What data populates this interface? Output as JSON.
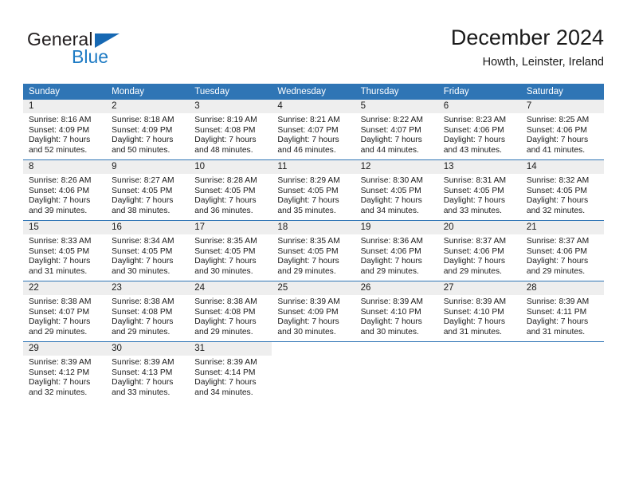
{
  "brand": {
    "name_part1": "General",
    "name_part2": "Blue",
    "triangle_color": "#1668b3",
    "blue_color": "#1e7bc4"
  },
  "header": {
    "title": "December 2024",
    "subtitle": "Howth, Leinster, Ireland"
  },
  "theme": {
    "header_bg": "#2f75b5",
    "day_band_bg": "#eeeeee",
    "text": "#1a1a1a"
  },
  "weekday_headers": [
    "Sunday",
    "Monday",
    "Tuesday",
    "Wednesday",
    "Thursday",
    "Friday",
    "Saturday"
  ],
  "weeks": [
    [
      {
        "day": "1",
        "sunrise": "Sunrise: 8:16 AM",
        "sunset": "Sunset: 4:09 PM",
        "daylight1": "Daylight: 7 hours",
        "daylight2": "and 52 minutes."
      },
      {
        "day": "2",
        "sunrise": "Sunrise: 8:18 AM",
        "sunset": "Sunset: 4:09 PM",
        "daylight1": "Daylight: 7 hours",
        "daylight2": "and 50 minutes."
      },
      {
        "day": "3",
        "sunrise": "Sunrise: 8:19 AM",
        "sunset": "Sunset: 4:08 PM",
        "daylight1": "Daylight: 7 hours",
        "daylight2": "and 48 minutes."
      },
      {
        "day": "4",
        "sunrise": "Sunrise: 8:21 AM",
        "sunset": "Sunset: 4:07 PM",
        "daylight1": "Daylight: 7 hours",
        "daylight2": "and 46 minutes."
      },
      {
        "day": "5",
        "sunrise": "Sunrise: 8:22 AM",
        "sunset": "Sunset: 4:07 PM",
        "daylight1": "Daylight: 7 hours",
        "daylight2": "and 44 minutes."
      },
      {
        "day": "6",
        "sunrise": "Sunrise: 8:23 AM",
        "sunset": "Sunset: 4:06 PM",
        "daylight1": "Daylight: 7 hours",
        "daylight2": "and 43 minutes."
      },
      {
        "day": "7",
        "sunrise": "Sunrise: 8:25 AM",
        "sunset": "Sunset: 4:06 PM",
        "daylight1": "Daylight: 7 hours",
        "daylight2": "and 41 minutes."
      }
    ],
    [
      {
        "day": "8",
        "sunrise": "Sunrise: 8:26 AM",
        "sunset": "Sunset: 4:06 PM",
        "daylight1": "Daylight: 7 hours",
        "daylight2": "and 39 minutes."
      },
      {
        "day": "9",
        "sunrise": "Sunrise: 8:27 AM",
        "sunset": "Sunset: 4:05 PM",
        "daylight1": "Daylight: 7 hours",
        "daylight2": "and 38 minutes."
      },
      {
        "day": "10",
        "sunrise": "Sunrise: 8:28 AM",
        "sunset": "Sunset: 4:05 PM",
        "daylight1": "Daylight: 7 hours",
        "daylight2": "and 36 minutes."
      },
      {
        "day": "11",
        "sunrise": "Sunrise: 8:29 AM",
        "sunset": "Sunset: 4:05 PM",
        "daylight1": "Daylight: 7 hours",
        "daylight2": "and 35 minutes."
      },
      {
        "day": "12",
        "sunrise": "Sunrise: 8:30 AM",
        "sunset": "Sunset: 4:05 PM",
        "daylight1": "Daylight: 7 hours",
        "daylight2": "and 34 minutes."
      },
      {
        "day": "13",
        "sunrise": "Sunrise: 8:31 AM",
        "sunset": "Sunset: 4:05 PM",
        "daylight1": "Daylight: 7 hours",
        "daylight2": "and 33 minutes."
      },
      {
        "day": "14",
        "sunrise": "Sunrise: 8:32 AM",
        "sunset": "Sunset: 4:05 PM",
        "daylight1": "Daylight: 7 hours",
        "daylight2": "and 32 minutes."
      }
    ],
    [
      {
        "day": "15",
        "sunrise": "Sunrise: 8:33 AM",
        "sunset": "Sunset: 4:05 PM",
        "daylight1": "Daylight: 7 hours",
        "daylight2": "and 31 minutes."
      },
      {
        "day": "16",
        "sunrise": "Sunrise: 8:34 AM",
        "sunset": "Sunset: 4:05 PM",
        "daylight1": "Daylight: 7 hours",
        "daylight2": "and 30 minutes."
      },
      {
        "day": "17",
        "sunrise": "Sunrise: 8:35 AM",
        "sunset": "Sunset: 4:05 PM",
        "daylight1": "Daylight: 7 hours",
        "daylight2": "and 30 minutes."
      },
      {
        "day": "18",
        "sunrise": "Sunrise: 8:35 AM",
        "sunset": "Sunset: 4:05 PM",
        "daylight1": "Daylight: 7 hours",
        "daylight2": "and 29 minutes."
      },
      {
        "day": "19",
        "sunrise": "Sunrise: 8:36 AM",
        "sunset": "Sunset: 4:06 PM",
        "daylight1": "Daylight: 7 hours",
        "daylight2": "and 29 minutes."
      },
      {
        "day": "20",
        "sunrise": "Sunrise: 8:37 AM",
        "sunset": "Sunset: 4:06 PM",
        "daylight1": "Daylight: 7 hours",
        "daylight2": "and 29 minutes."
      },
      {
        "day": "21",
        "sunrise": "Sunrise: 8:37 AM",
        "sunset": "Sunset: 4:06 PM",
        "daylight1": "Daylight: 7 hours",
        "daylight2": "and 29 minutes."
      }
    ],
    [
      {
        "day": "22",
        "sunrise": "Sunrise: 8:38 AM",
        "sunset": "Sunset: 4:07 PM",
        "daylight1": "Daylight: 7 hours",
        "daylight2": "and 29 minutes."
      },
      {
        "day": "23",
        "sunrise": "Sunrise: 8:38 AM",
        "sunset": "Sunset: 4:08 PM",
        "daylight1": "Daylight: 7 hours",
        "daylight2": "and 29 minutes."
      },
      {
        "day": "24",
        "sunrise": "Sunrise: 8:38 AM",
        "sunset": "Sunset: 4:08 PM",
        "daylight1": "Daylight: 7 hours",
        "daylight2": "and 29 minutes."
      },
      {
        "day": "25",
        "sunrise": "Sunrise: 8:39 AM",
        "sunset": "Sunset: 4:09 PM",
        "daylight1": "Daylight: 7 hours",
        "daylight2": "and 30 minutes."
      },
      {
        "day": "26",
        "sunrise": "Sunrise: 8:39 AM",
        "sunset": "Sunset: 4:10 PM",
        "daylight1": "Daylight: 7 hours",
        "daylight2": "and 30 minutes."
      },
      {
        "day": "27",
        "sunrise": "Sunrise: 8:39 AM",
        "sunset": "Sunset: 4:10 PM",
        "daylight1": "Daylight: 7 hours",
        "daylight2": "and 31 minutes."
      },
      {
        "day": "28",
        "sunrise": "Sunrise: 8:39 AM",
        "sunset": "Sunset: 4:11 PM",
        "daylight1": "Daylight: 7 hours",
        "daylight2": "and 31 minutes."
      }
    ],
    [
      {
        "day": "29",
        "sunrise": "Sunrise: 8:39 AM",
        "sunset": "Sunset: 4:12 PM",
        "daylight1": "Daylight: 7 hours",
        "daylight2": "and 32 minutes."
      },
      {
        "day": "30",
        "sunrise": "Sunrise: 8:39 AM",
        "sunset": "Sunset: 4:13 PM",
        "daylight1": "Daylight: 7 hours",
        "daylight2": "and 33 minutes."
      },
      {
        "day": "31",
        "sunrise": "Sunrise: 8:39 AM",
        "sunset": "Sunset: 4:14 PM",
        "daylight1": "Daylight: 7 hours",
        "daylight2": "and 34 minutes."
      },
      {
        "day": "",
        "sunrise": "",
        "sunset": "",
        "daylight1": "",
        "daylight2": ""
      },
      {
        "day": "",
        "sunrise": "",
        "sunset": "",
        "daylight1": "",
        "daylight2": ""
      },
      {
        "day": "",
        "sunrise": "",
        "sunset": "",
        "daylight1": "",
        "daylight2": ""
      },
      {
        "day": "",
        "sunrise": "",
        "sunset": "",
        "daylight1": "",
        "daylight2": ""
      }
    ]
  ]
}
